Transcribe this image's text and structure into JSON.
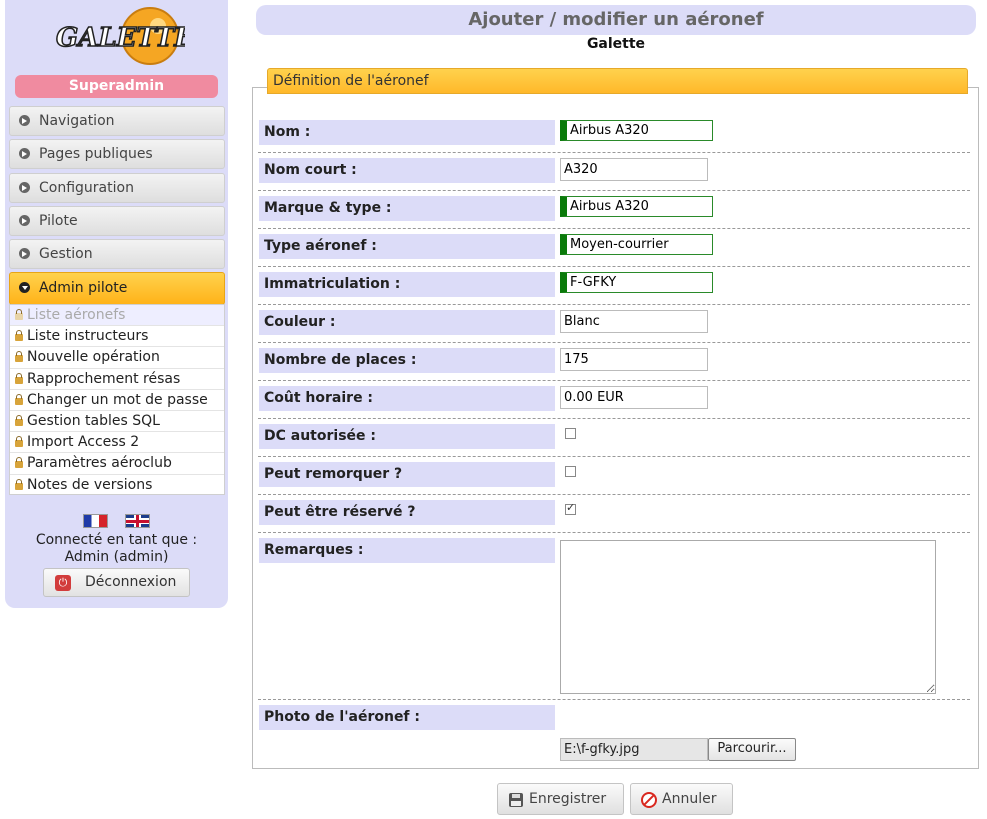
{
  "app": {
    "logo_text": "GALETTE"
  },
  "sidebar": {
    "role": "Superadmin",
    "menu": [
      {
        "label": "Navigation"
      },
      {
        "label": "Pages publiques"
      },
      {
        "label": "Configuration"
      },
      {
        "label": "Pilote"
      },
      {
        "label": "Gestion"
      },
      {
        "label": "Admin pilote",
        "active": true
      }
    ],
    "submenu": [
      {
        "label": "Liste aéronefs",
        "selected": true
      },
      {
        "label": "Liste instructeurs"
      },
      {
        "label": "Nouvelle opération"
      },
      {
        "label": "Rapprochement résas"
      },
      {
        "label": "Changer un mot de passe"
      },
      {
        "label": "Gestion tables SQL"
      },
      {
        "label": "Import Access 2"
      },
      {
        "label": "Paramètres aéroclub"
      },
      {
        "label": "Notes de versions"
      }
    ],
    "languages": [
      "French",
      "English"
    ],
    "connected_as_line1": "Connecté en tant que :",
    "connected_as_line2": "Admin (admin)",
    "logout_label": "Déconnexion"
  },
  "page": {
    "title": "Ajouter / modifier un aéronef",
    "subtitle": "Galette",
    "legend": "Définition de l'aéronef"
  },
  "form": {
    "nom": {
      "label": "Nom :",
      "value": "Airbus A320",
      "required": true
    },
    "nom_court": {
      "label": "Nom court :",
      "value": "A320"
    },
    "marque_type": {
      "label": "Marque & type :",
      "value": "Airbus A320",
      "required": true
    },
    "type_aeronef": {
      "label": "Type aéronef :",
      "value": "Moyen-courrier",
      "required": true
    },
    "immatriculation": {
      "label": "Immatriculation :",
      "value": "F-GFKY",
      "required": true
    },
    "couleur": {
      "label": "Couleur :",
      "value": "Blanc"
    },
    "nombre_places": {
      "label": "Nombre de places :",
      "value": "175"
    },
    "cout_horaire": {
      "label": "Coût horaire :",
      "value": "0.00 EUR"
    },
    "dc_autorisee": {
      "label": "DC autorisée :",
      "checked": false
    },
    "peut_remorquer": {
      "label": "Peut remorquer ?",
      "checked": false
    },
    "peut_etre_reserve": {
      "label": "Peut être réservé ?",
      "checked": true
    },
    "remarques": {
      "label": "Remarques :",
      "value": ""
    },
    "photo": {
      "label": "Photo de l'aéronef :",
      "file": "E:\\f-gfky.jpg",
      "browse_label": "Parcourir..."
    }
  },
  "actions": {
    "save_label": "Enregistrer",
    "cancel_label": "Annuler"
  }
}
